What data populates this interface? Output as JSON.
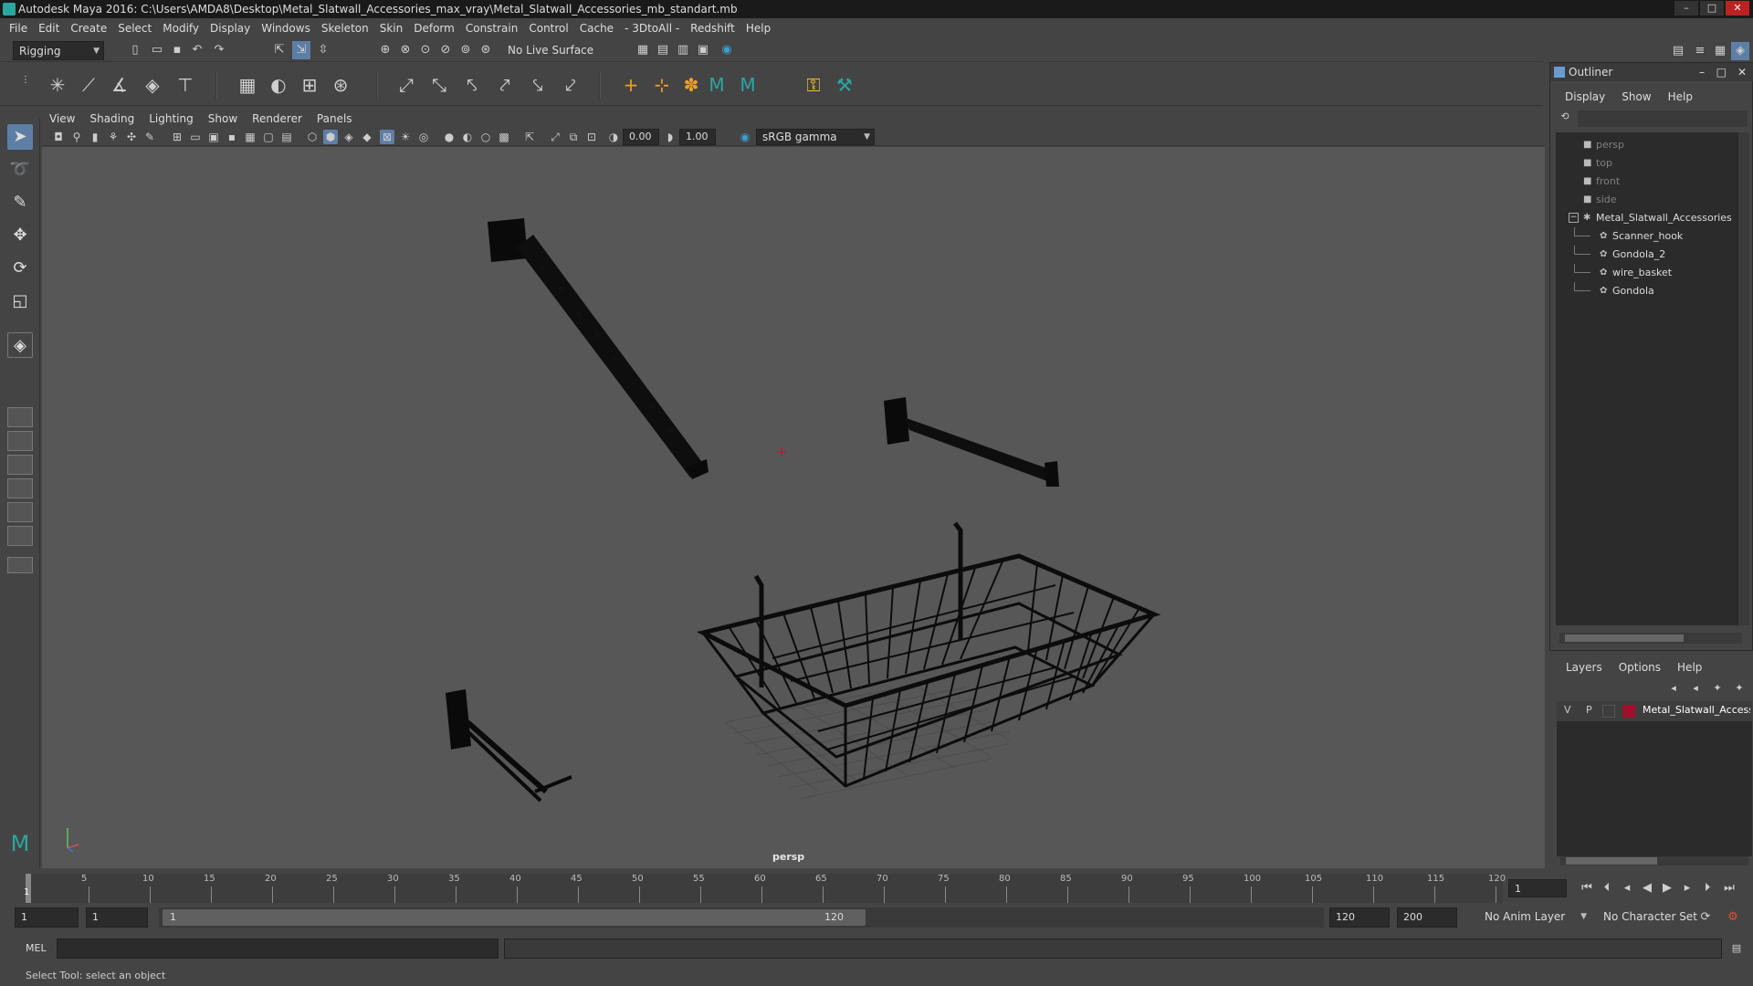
{
  "window": {
    "title": "Autodesk Maya 2016: C:\\Users\\AMDA8\\Desktop\\Metal_Slatwall_Accessories_max_vray\\Metal_Slatwall_Accessories_mb_standart.mb"
  },
  "menubar": [
    "File",
    "Edit",
    "Create",
    "Select",
    "Modify",
    "Display",
    "Windows",
    "Skeleton",
    "Skin",
    "Deform",
    "Constrain",
    "Control",
    "Cache",
    "- 3DtoAll -",
    "Redshift",
    "Help"
  ],
  "statusline": {
    "mode_menu": "Rigging",
    "live_surface": "No Live Surface"
  },
  "viewport_menu": [
    "View",
    "Shading",
    "Lighting",
    "Show",
    "Renderer",
    "Panels"
  ],
  "viewport_toolbar": {
    "exposure": "0.00",
    "gamma": "1.00",
    "color_space": "sRGB gamma"
  },
  "viewport": {
    "camera_label": "persp"
  },
  "outliner": {
    "title": "Outliner",
    "menu": [
      "Display",
      "Show",
      "Help"
    ],
    "items": [
      {
        "label": "persp",
        "dim": true
      },
      {
        "label": "top",
        "dim": true
      },
      {
        "label": "front",
        "dim": true
      },
      {
        "label": "side",
        "dim": true
      },
      {
        "label": "Metal_Slatwall_Accessories",
        "dim": false
      },
      {
        "label": "Scanner_hook",
        "dim": false
      },
      {
        "label": "Gondola_2",
        "dim": false
      },
      {
        "label": "wire_basket",
        "dim": false
      },
      {
        "label": "Gondola",
        "dim": false
      }
    ]
  },
  "layers": {
    "menu": [
      "Layers",
      "Options",
      "Help"
    ],
    "row": {
      "v": "V",
      "p": "P",
      "name": "Metal_Slatwall_Accessories",
      "color": "#a0102a"
    }
  },
  "timeline": {
    "ticks": [
      "5",
      "10",
      "15",
      "20",
      "25",
      "30",
      "35",
      "40",
      "45",
      "50",
      "55",
      "60",
      "65",
      "70",
      "75",
      "80",
      "85",
      "90",
      "95",
      "100",
      "105",
      "110",
      "115",
      "120"
    ],
    "start_mark": "1",
    "current_frame": "1"
  },
  "range": {
    "start": "1",
    "playback_start": "1",
    "slider_start": "1",
    "slider_end": "120",
    "playback_end": "120",
    "end": "200",
    "anim_layer": "No Anim Layer",
    "character_set": "No Character Set"
  },
  "commandline": {
    "label": "MEL"
  },
  "helpline": {
    "text": "Select Tool: select an object"
  }
}
